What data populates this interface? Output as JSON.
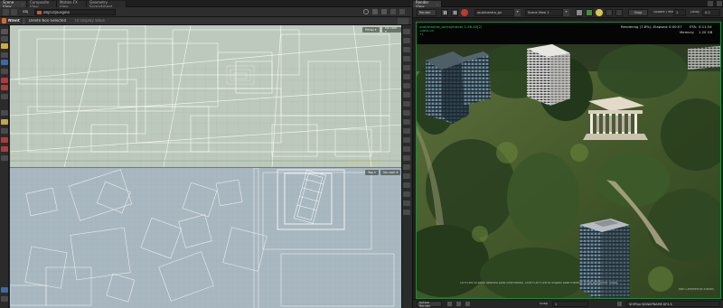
{
  "left": {
    "tabs": [
      {
        "label": "Scene View",
        "active": true
      },
      {
        "label": "Composite View",
        "active": false
      },
      {
        "label": "Motion FX View",
        "active": false
      },
      {
        "label": "Geometry Spreadsheet",
        "active": false
      }
    ],
    "toolbar": {
      "context": "obj",
      "path": "obj/CityEngine"
    },
    "shelf": {
      "brand": "Ntent",
      "selection_label": "Delete Non-Selected",
      "button2": "Fit Display Value"
    },
    "viewport_top": {
      "view_menu": "Persp ▾",
      "cam_menu": "No cam ▾",
      "label": "Non-Commercial Edition"
    },
    "viewport_bottom": {
      "view_menu": "Top ▾",
      "cam_menu": "No cam ▾"
    }
  },
  "right": {
    "tabs": [
      {
        "label": "Render View",
        "active": true
      }
    ],
    "toolbar": {
      "render_button": "Render",
      "rop_field": "/out/mantra_ipr",
      "camera_field": "Scene View 1",
      "snap_button": "Snap",
      "update_label": "Update Time",
      "update_value": "1",
      "delay_label": "Delay",
      "delay_value": "0.2"
    },
    "info": {
      "path": "/out/mantra_ipr(raytrace) 1.56.40[2]",
      "resolution": "1280x720",
      "frame": "+1",
      "status": "Rendering (7.8%)...",
      "elapsed_label": "Elapsed:",
      "elapsed": "0:00:57",
      "eta_label": "ETA:",
      "eta": "0:11:34",
      "memory_label": "Memory:",
      "memory": "1.20 GB"
    },
    "footer_hint": "Ctrl+Left to show detailed pixel information. Shift+Ctrl+Left to inspect base material in the parameter dialog.",
    "watermark": "Non-Commercial Edition",
    "bottom": {
      "auto_button": "Active Render",
      "snap_label": "Snap",
      "snap_value": "1",
      "file_field": "$HIP/ipr/$SNAPNAME.$F4.$"
    }
  },
  "colors": {
    "accent_green": "#1f8a3a",
    "stop_red": "#c0392b",
    "render_text": "#35c96a",
    "viewport_top_bg": "#bcc9bc",
    "viewport_bot_bg": "#a9b8c0"
  },
  "icons": [
    "houdini-logo-icon",
    "stop-icon",
    "pause-icon",
    "play-icon",
    "snapshot-icon",
    "lightbulb-icon",
    "chevron-down-icon"
  ]
}
